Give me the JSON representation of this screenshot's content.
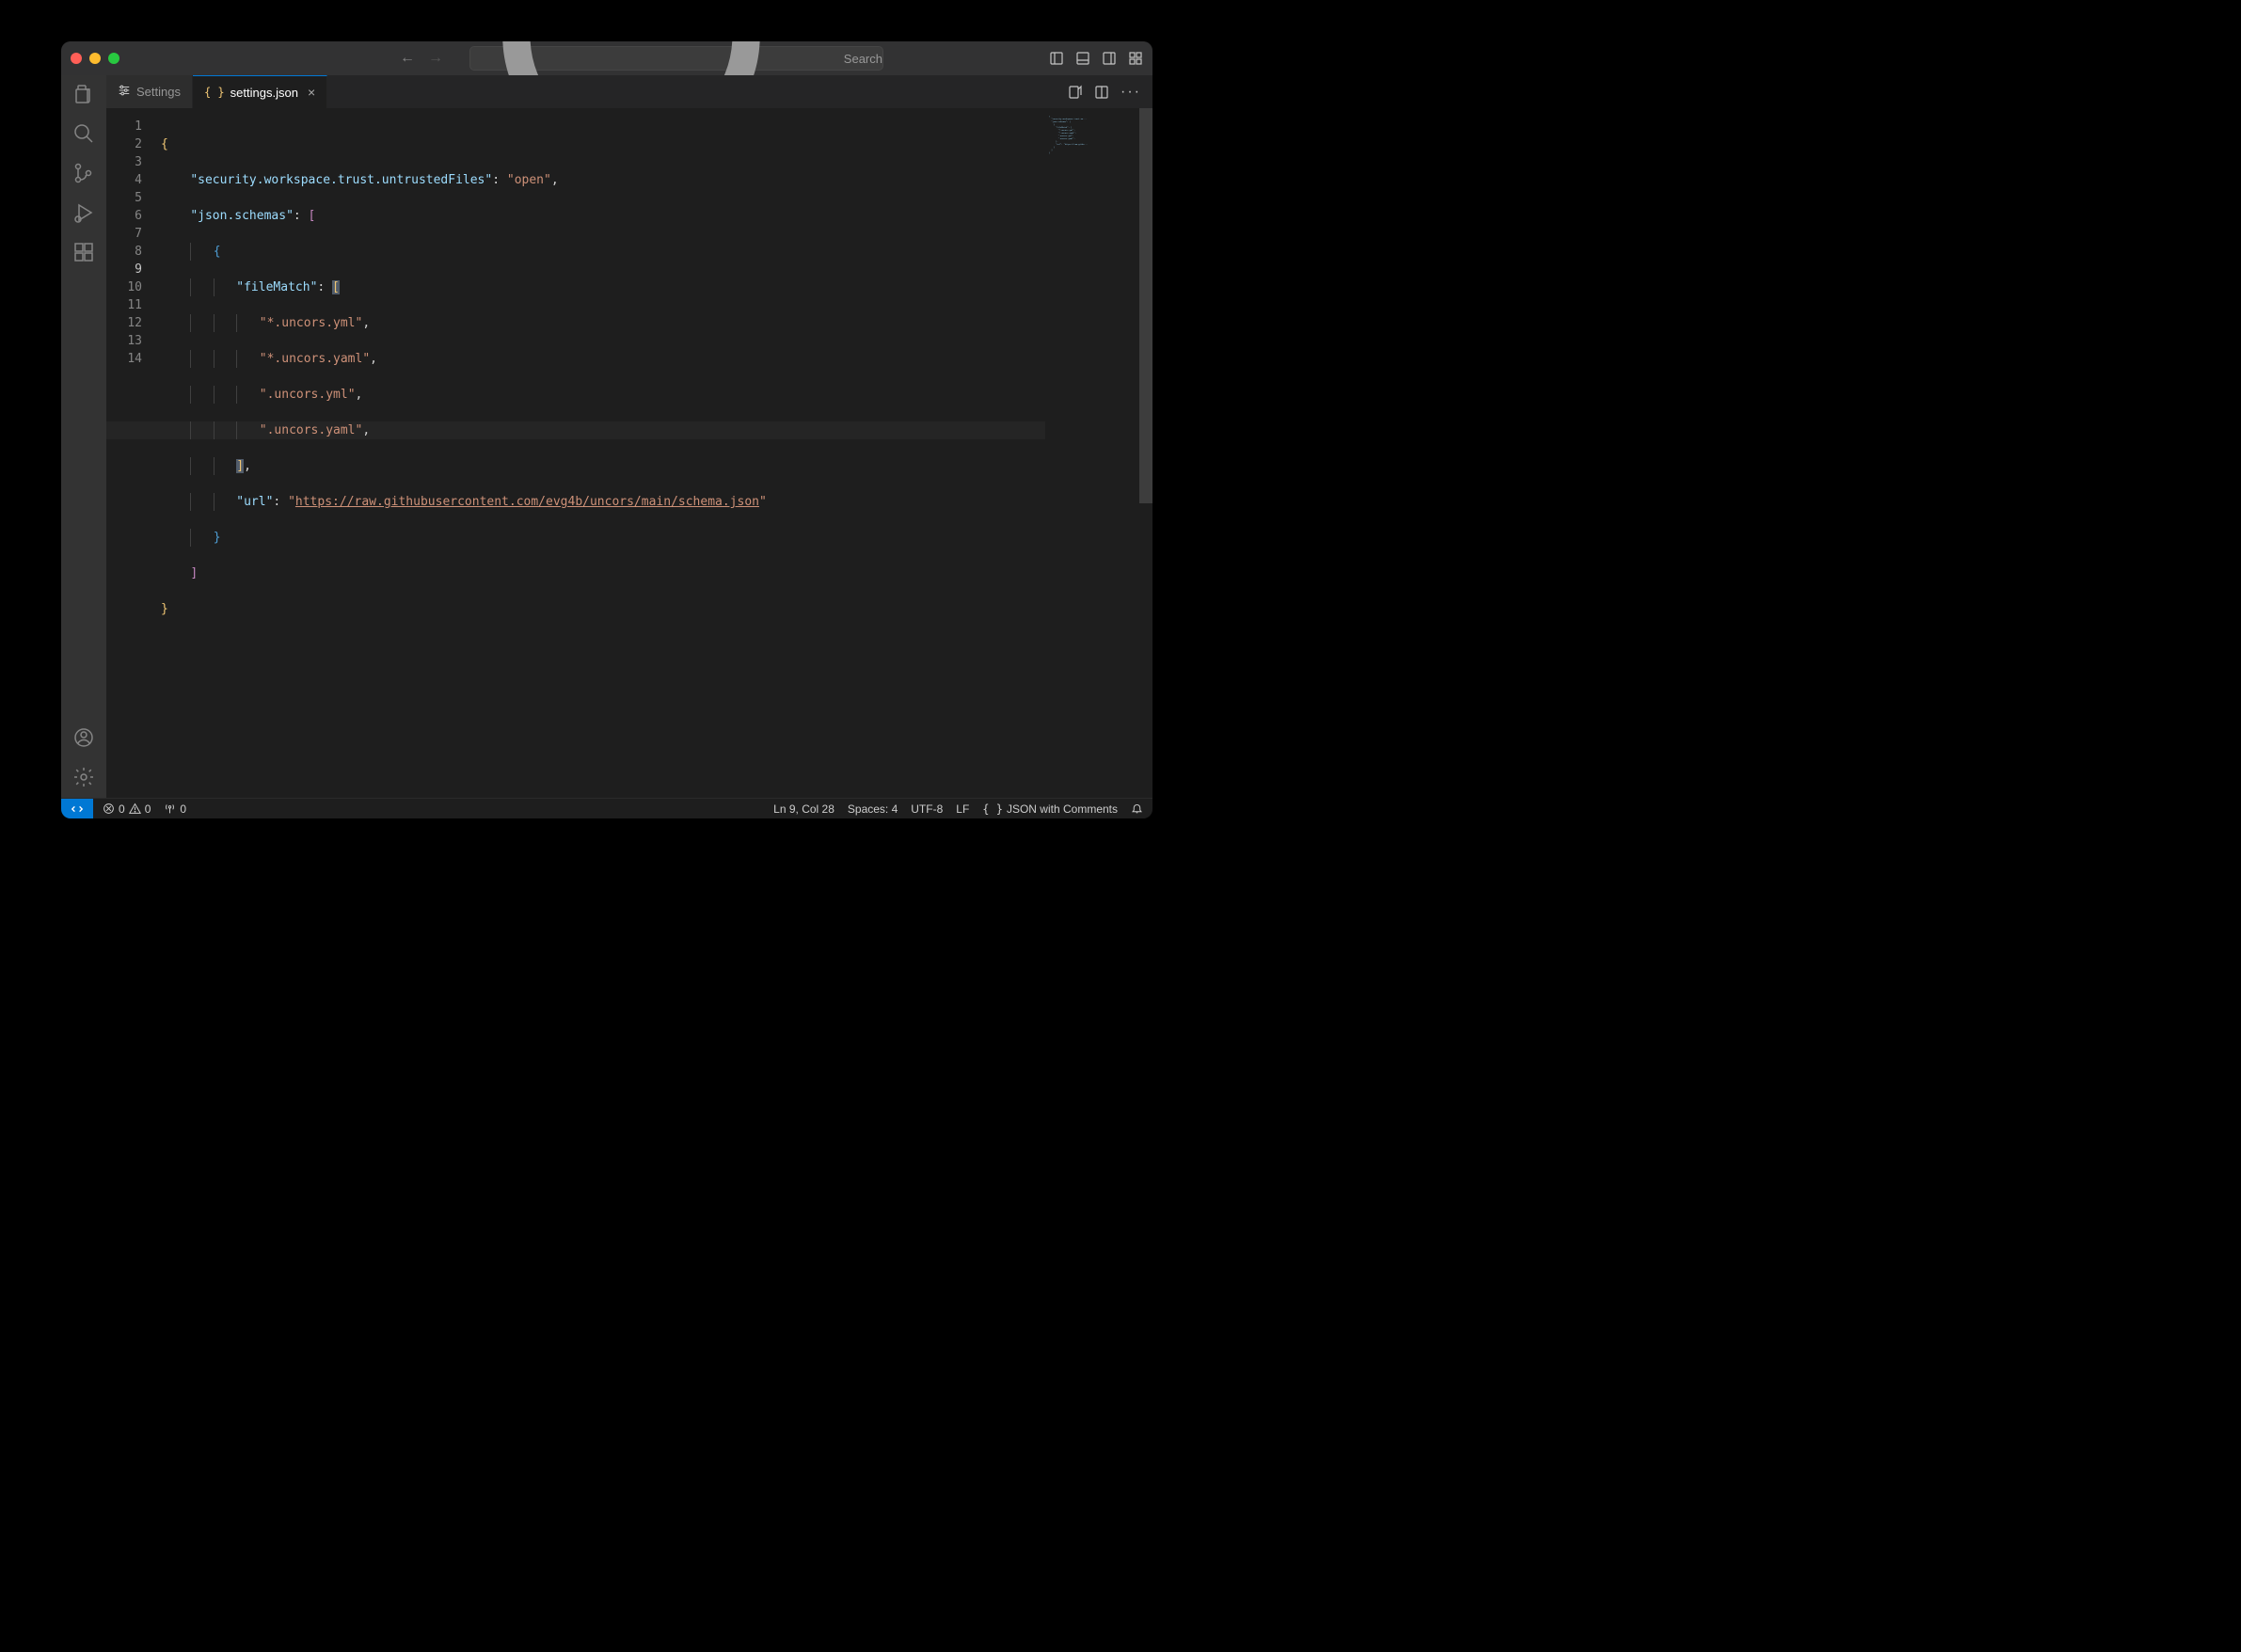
{
  "titlebar": {
    "search_placeholder": "Search"
  },
  "tabs": [
    {
      "icon": "list",
      "label": "Settings",
      "active": false,
      "dirty": false
    },
    {
      "icon": "braces",
      "label": "settings.json",
      "active": true,
      "dirty": false
    }
  ],
  "editor": {
    "line_count": 14,
    "current_line": 9,
    "lines": [
      "{",
      "    \"security.workspace.trust.untrustedFiles\": \"open\",",
      "    \"json.schemas\": [",
      "        {",
      "            \"fileMatch\": [",
      "                \"*.uncors.yml\",",
      "                \"*.uncors.yaml\",",
      "                \".uncors.yml\",",
      "                \".uncors.yaml\",",
      "            ],",
      "            \"url\": \"https://raw.githubusercontent.com/evg4b/uncors/main/schema.json\"",
      "        }",
      "    ]",
      "}"
    ],
    "content_keys": {
      "security_key": "security.workspace.trust.untrustedFiles",
      "security_val": "open",
      "schemas_key": "json.schemas",
      "filematch_key": "fileMatch",
      "filematch_vals": [
        "*.uncors.yml",
        "*.uncors.yaml",
        ".uncors.yml",
        ".uncors.yaml"
      ],
      "url_key": "url",
      "url_val": "https://raw.githubusercontent.com/evg4b/uncors/main/schema.json"
    }
  },
  "statusbar": {
    "errors": "0",
    "warnings": "0",
    "ports": "0",
    "cursor": "Ln 9, Col 28",
    "spaces": "Spaces: 4",
    "encoding": "UTF-8",
    "eol": "LF",
    "language": "JSON with Comments"
  }
}
